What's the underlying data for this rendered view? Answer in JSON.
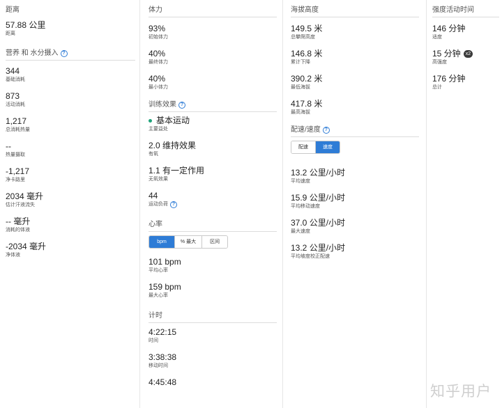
{
  "col1": {
    "distance": {
      "title": "距离",
      "value": "57.88 公里",
      "label": "距离"
    },
    "nutrition_title": "营养 和 水分摄入",
    "stats": [
      {
        "value": "344",
        "label": "基础消耗"
      },
      {
        "value": "873",
        "label": "活动消耗"
      },
      {
        "value": "1,217",
        "label": "总消耗热量"
      },
      {
        "value": "--",
        "label": "热量摄取"
      },
      {
        "value": "-1,217",
        "label": "净卡路里"
      },
      {
        "value": "2034 毫升",
        "label": "估计汗液流失"
      },
      {
        "value": "-- 毫升",
        "label": "消耗的体液"
      },
      {
        "value": "-2034 毫升",
        "label": "净体液"
      }
    ]
  },
  "col2": {
    "stamina_title": "体力",
    "stamina": [
      {
        "value": "93%",
        "label": "初始体力"
      },
      {
        "value": "40%",
        "label": "最终体力"
      },
      {
        "value": "40%",
        "label": "最小体力"
      }
    ],
    "training_title": "训练效果",
    "training": [
      {
        "value": "基本运动",
        "label": "主要益处"
      },
      {
        "value": "2.0 维持效果",
        "label": "有氧"
      },
      {
        "value": "1.1 有一定作用",
        "label": "无氧效果"
      },
      {
        "value": "44",
        "label": "运动负荷"
      }
    ],
    "hr_title": "心率",
    "hr_tabs": [
      "bpm",
      "% 最大",
      "区间"
    ],
    "hr": [
      {
        "value": "101 bpm",
        "label": "平均心率"
      },
      {
        "value": "159 bpm",
        "label": "最大心率"
      }
    ],
    "timing_title": "计时",
    "timing": [
      {
        "value": "4:22:15",
        "label": "时间"
      },
      {
        "value": "3:38:38",
        "label": "移动时间"
      },
      {
        "value": "4:45:48",
        "label": ""
      }
    ]
  },
  "col3": {
    "elev_title": "海拔高度",
    "elev": [
      {
        "value": "149.5 米",
        "label": "总攀爬高度"
      },
      {
        "value": "146.8 米",
        "label": "累计下降"
      },
      {
        "value": "390.2 米",
        "label": "最低海拔"
      },
      {
        "value": "417.8 米",
        "label": "最高海拔"
      }
    ],
    "pace_title": "配速/速度",
    "pace_tabs": [
      "配速",
      "速度"
    ],
    "speed": [
      {
        "value": "13.2 公里/小时",
        "label": "平均速度"
      },
      {
        "value": "15.9 公里/小时",
        "label": "平均移动速度"
      },
      {
        "value": "37.0 公里/小时",
        "label": "最大速度"
      },
      {
        "value": "13.2 公里/小时",
        "label": "平均坡度校正配速"
      }
    ]
  },
  "col4": {
    "intensity_title": "强度活动时间",
    "intensity": [
      {
        "value": "146 分钟",
        "label": "适度"
      },
      {
        "value": "15 分钟",
        "label": "高强度",
        "badge": "x2"
      },
      {
        "value": "176 分钟",
        "label": "总计"
      }
    ]
  },
  "watermark": "知乎用户",
  "colors": {
    "accent": "#2e7cd6",
    "dot": "#1fa37a"
  }
}
